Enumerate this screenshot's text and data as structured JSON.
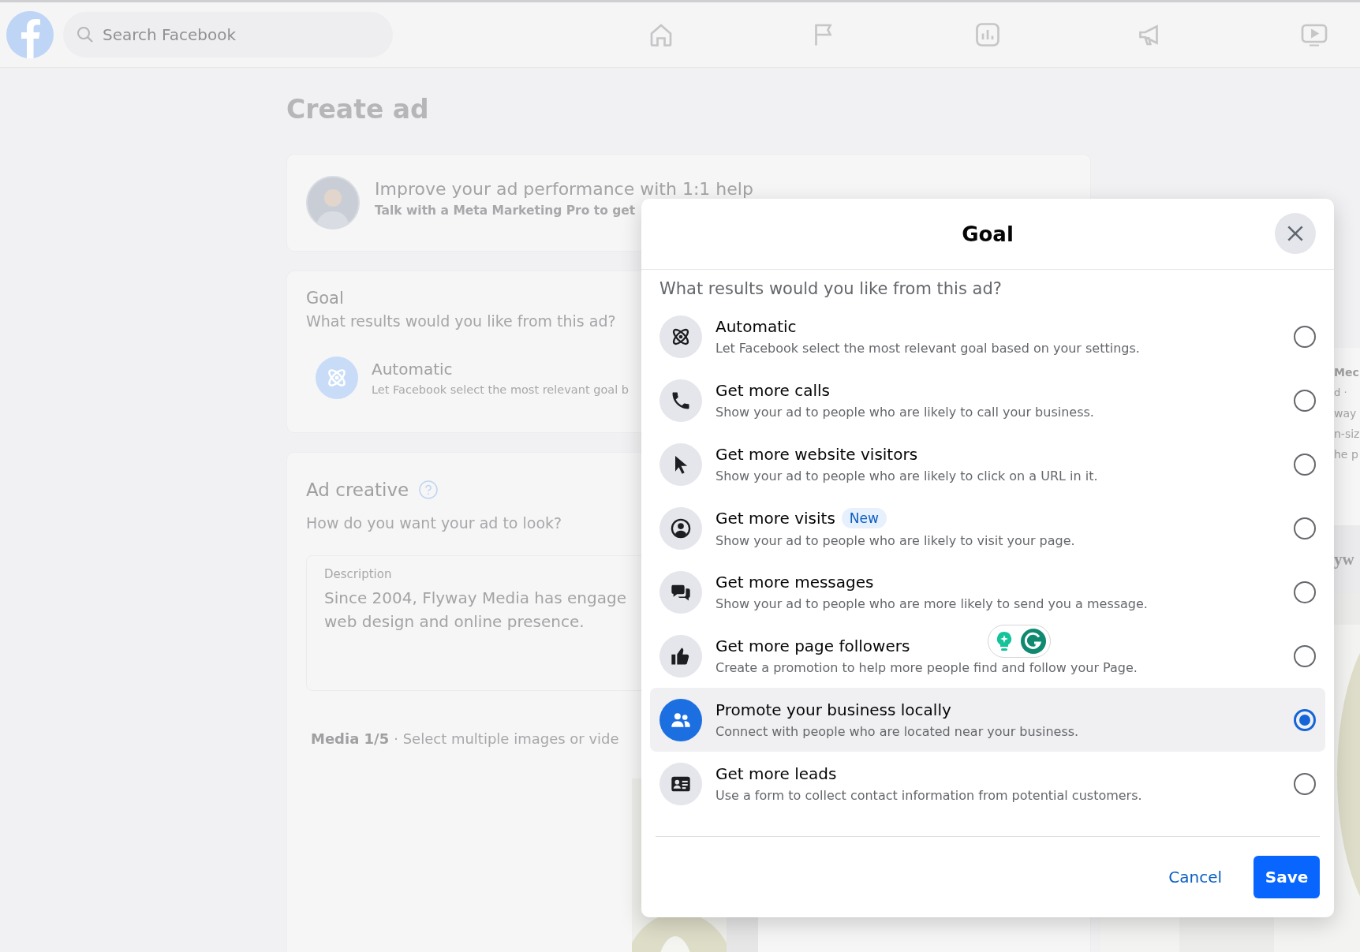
{
  "top_bar": {
    "search": {
      "placeholder": "Search Facebook"
    }
  },
  "page": {
    "title": "Create ad",
    "help_card": {
      "title": "Improve your ad performance with 1:1 help",
      "subtitle": "Talk with a Meta Marketing Pro to get"
    },
    "goal_card": {
      "title": "Goal",
      "question": "What results would you like from this ad?",
      "option_title": "Automatic",
      "option_description": "Let Facebook select the most relevant goal b"
    },
    "ad_creative": {
      "title": "Ad creative",
      "question": "How do you want your ad to look?",
      "description": {
        "label": "Description",
        "value_lines": [
          "Since 2004, Flyway Media has engage",
          "web design and online presence."
        ]
      },
      "media_label": "Media 1/5",
      "media_hint": "· Select multiple images or vide"
    }
  },
  "preview": {
    "fragments": [
      {
        "kind": "name",
        "text": "Mec"
      },
      {
        "kind": "meta",
        "text": "d ·"
      },
      {
        "kind": "body",
        "text": "way"
      },
      {
        "kind": "body",
        "text": "n-siz"
      },
      {
        "kind": "body",
        "text": "he p"
      },
      {
        "kind": "banner",
        "text": "yw"
      }
    ]
  },
  "dialog": {
    "title": "Goal",
    "question": "What results would you like from this ad?",
    "options": [
      {
        "kind": "automatic",
        "title": "Automatic",
        "description": "Let Facebook select the most relevant goal based on your settings.",
        "selected": false
      },
      {
        "kind": "calls",
        "title": "Get more calls",
        "description": "Show your ad to people who are likely to call your business.",
        "selected": false
      },
      {
        "kind": "website",
        "title": "Get more website visitors",
        "description": "Show your ad to people who are likely to click on a URL in it.",
        "selected": false
      },
      {
        "kind": "visits",
        "title": "Get more visits",
        "badge": "New",
        "description": "Show your ad to people who are likely to visit your page.",
        "selected": false
      },
      {
        "kind": "messages",
        "title": "Get more messages",
        "description": "Show your ad to people who are more likely to send you a message.",
        "selected": false
      },
      {
        "kind": "followers",
        "title": "Get more page followers",
        "description": "Create a promotion to help more people find and follow your Page.",
        "selected": false
      },
      {
        "kind": "local",
        "title": "Promote your business locally",
        "description": "Connect with people who are located near your business.",
        "selected": true
      },
      {
        "kind": "leads",
        "title": "Get more leads",
        "description": "Use a form to collect contact information from potential customers.",
        "selected": false
      }
    ],
    "cancel": "Cancel",
    "save": "Save"
  }
}
